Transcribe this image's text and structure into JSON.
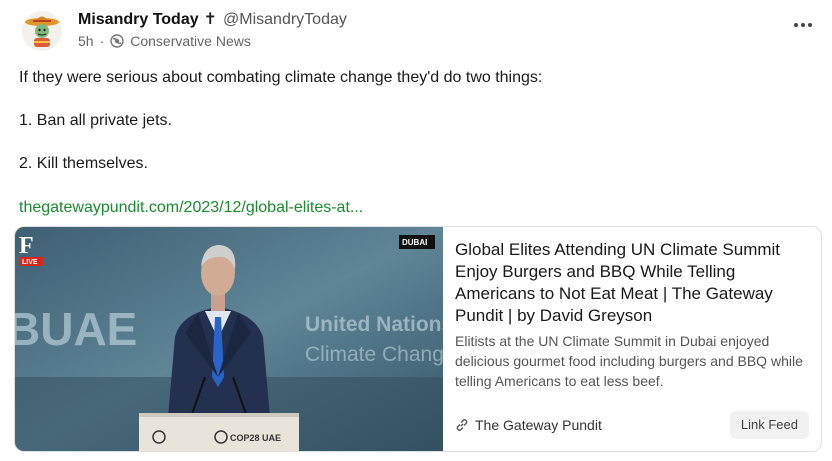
{
  "post": {
    "author_name": "Misandry Today",
    "author_symbol": "✝",
    "handle": "@MisandryToday",
    "time": "5h",
    "separator": "·",
    "category": "Conservative News",
    "avatar_icon": "cartoon-avatar-sombrero",
    "more_icon": "more-options-icon",
    "paragraphs": [
      "If they were serious about combating climate change they'd do two things:",
      "1. Ban all private jets.",
      "2. Kill themselves."
    ],
    "link_text": "thegatewaypundit.com/2023/12/global-elites-at..."
  },
  "card": {
    "title": "Global Elites Attending UN Climate Summit Enjoy Burgers and BBQ While Telling Americans to Not Eat Meat | The Gateway Pundit | by David Greyson",
    "description": "Elitists at the UN Climate Summit in Dubai enjoyed delicious gourmet food including burgers and BBQ while telling Americans to eat less beef.",
    "source": "The Gateway Pundit",
    "button_label": "Link Feed",
    "thumbnail": {
      "logo_letter": "F",
      "live_label": "LIVE",
      "location_label": "DUBAI",
      "bg_text_left": "BUAE",
      "bg_text_line1": "United Nations",
      "bg_text_line2": "Climate Change",
      "podium_text": "COP28 UAE"
    }
  },
  "colors": {
    "link": "#1a8b2e",
    "badge_red": "#d7261e"
  }
}
